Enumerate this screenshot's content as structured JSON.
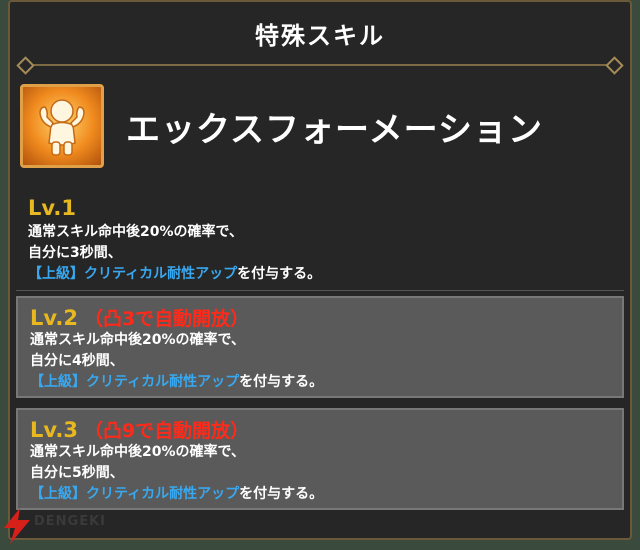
{
  "dialog": {
    "title": "特殊スキル"
  },
  "skill": {
    "name": "エックスフォーメーション",
    "icon": "flexing-character-icon"
  },
  "levels": [
    {
      "label": "Lv.1",
      "unlock": "",
      "line1": "通常スキル命中後20%の確率で、",
      "line2": "自分に3秒間、",
      "effect": "【上級】クリティカル耐性アップ",
      "suffix": "を付与する。"
    },
    {
      "label": "Lv.2",
      "unlock": "（凸3で自動開放）",
      "line1": "通常スキル命中後20%の確率で、",
      "line2": "自分に4秒間、",
      "effect": "【上級】クリティカル耐性アップ",
      "suffix": "を付与する。"
    },
    {
      "label": "Lv.3",
      "unlock": "（凸9で自動開放）",
      "line1": "通常スキル命中後20%の確率で、",
      "line2": "自分に5秒間、",
      "effect": "【上級】クリティカル耐性アップ",
      "suffix": "を付与する。"
    }
  ],
  "watermark": {
    "text": "DENGEKI"
  },
  "colors": {
    "panel": "#262626",
    "level_label": "#e8b820",
    "unlock_text": "#ff2a1a",
    "effect_highlight": "#38a8f0",
    "locked_bg": "#5a5a5a"
  }
}
